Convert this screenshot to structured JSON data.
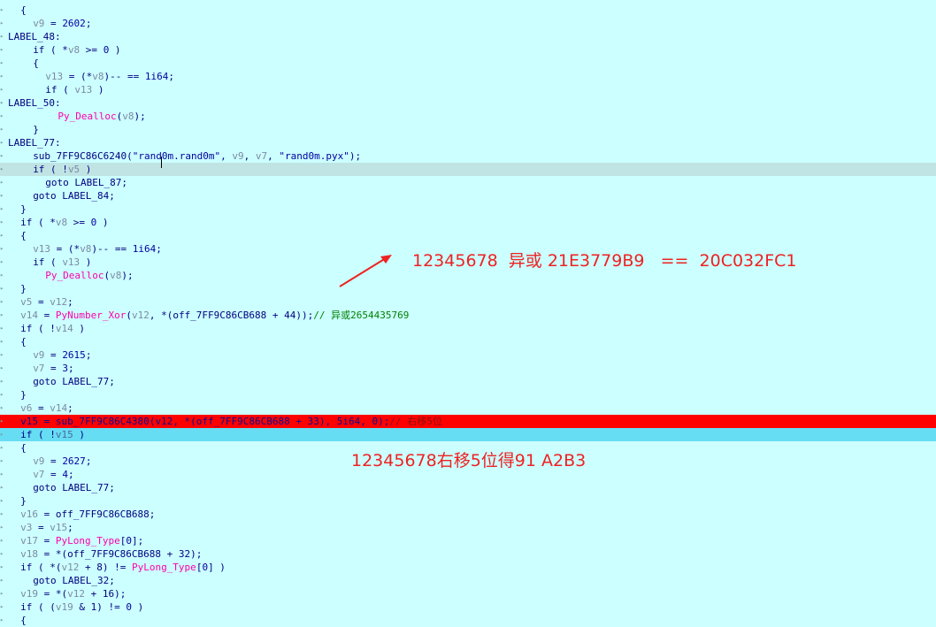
{
  "code_lines": [
    {
      "indent": 3,
      "tokens": [
        {
          "t": "pl",
          "v": "{"
        }
      ]
    },
    {
      "indent": 5,
      "tokens": [
        {
          "t": "var",
          "v": "v9"
        },
        {
          "t": "pl",
          "v": " = "
        },
        {
          "t": "num",
          "v": "2602"
        },
        {
          "t": "pl",
          "v": ";"
        }
      ]
    },
    {
      "indent": 1,
      "tokens": [
        {
          "t": "lbl",
          "v": "LABEL_48:"
        }
      ]
    },
    {
      "indent": 5,
      "tokens": [
        {
          "t": "kw",
          "v": "if"
        },
        {
          "t": "pl",
          "v": " ( *"
        },
        {
          "t": "var",
          "v": "v8"
        },
        {
          "t": "pl",
          "v": " >= "
        },
        {
          "t": "num",
          "v": "0"
        },
        {
          "t": "pl",
          "v": " )"
        }
      ]
    },
    {
      "indent": 5,
      "tokens": [
        {
          "t": "pl",
          "v": "{"
        }
      ]
    },
    {
      "indent": 7,
      "tokens": [
        {
          "t": "var",
          "v": "v13"
        },
        {
          "t": "pl",
          "v": " = (*"
        },
        {
          "t": "var",
          "v": "v8"
        },
        {
          "t": "pl",
          "v": ")-- == "
        },
        {
          "t": "num",
          "v": "1i64"
        },
        {
          "t": "pl",
          "v": ";"
        }
      ]
    },
    {
      "indent": 7,
      "tokens": [
        {
          "t": "kw",
          "v": "if"
        },
        {
          "t": "pl",
          "v": " ( "
        },
        {
          "t": "var",
          "v": "v13"
        },
        {
          "t": "pl",
          "v": " )"
        }
      ]
    },
    {
      "indent": 1,
      "tokens": [
        {
          "t": "lbl",
          "v": "LABEL_50:"
        }
      ]
    },
    {
      "indent": 9,
      "tokens": [
        {
          "t": "fn",
          "v": "Py_Dealloc"
        },
        {
          "t": "pl",
          "v": "("
        },
        {
          "t": "var",
          "v": "v8"
        },
        {
          "t": "pl",
          "v": ");"
        }
      ]
    },
    {
      "indent": 5,
      "tokens": [
        {
          "t": "pl",
          "v": "}"
        }
      ]
    },
    {
      "indent": 1,
      "tokens": [
        {
          "t": "lbl",
          "v": "LABEL_77:"
        }
      ]
    },
    {
      "indent": 5,
      "tokens": [
        {
          "t": "pl",
          "v": "sub_7FF9C86C6240("
        },
        {
          "t": "str",
          "v": "\"rand0m.rand0m\""
        },
        {
          "t": "pl",
          "v": ", "
        },
        {
          "t": "var",
          "v": "v9"
        },
        {
          "t": "pl",
          "v": ", "
        },
        {
          "t": "var",
          "v": "v7"
        },
        {
          "t": "pl",
          "v": ", "
        },
        {
          "t": "str",
          "v": "\"rand0m.pyx\""
        },
        {
          "t": "pl",
          "v": ");"
        }
      ]
    },
    {
      "indent": 5,
      "hl": "cursor",
      "tokens": [
        {
          "t": "kw",
          "v": "if"
        },
        {
          "t": "pl",
          "v": " ( !"
        },
        {
          "t": "var",
          "v": "v5"
        },
        {
          "t": "pl",
          "v": " )"
        }
      ]
    },
    {
      "indent": 7,
      "tokens": [
        {
          "t": "kw",
          "v": "goto"
        },
        {
          "t": "pl",
          "v": " LABEL_87;"
        }
      ]
    },
    {
      "indent": 5,
      "tokens": [
        {
          "t": "kw",
          "v": "goto"
        },
        {
          "t": "pl",
          "v": " LABEL_84;"
        }
      ]
    },
    {
      "indent": 3,
      "tokens": [
        {
          "t": "pl",
          "v": "}"
        }
      ]
    },
    {
      "indent": 3,
      "tokens": [
        {
          "t": "kw",
          "v": "if"
        },
        {
          "t": "pl",
          "v": " ( *"
        },
        {
          "t": "var",
          "v": "v8"
        },
        {
          "t": "pl",
          "v": " >= "
        },
        {
          "t": "num",
          "v": "0"
        },
        {
          "t": "pl",
          "v": " )"
        }
      ]
    },
    {
      "indent": 3,
      "tokens": [
        {
          "t": "pl",
          "v": "{"
        }
      ]
    },
    {
      "indent": 5,
      "tokens": [
        {
          "t": "var",
          "v": "v13"
        },
        {
          "t": "pl",
          "v": " = (*"
        },
        {
          "t": "var",
          "v": "v8"
        },
        {
          "t": "pl",
          "v": ")-- == "
        },
        {
          "t": "num",
          "v": "1i64"
        },
        {
          "t": "pl",
          "v": ";"
        }
      ]
    },
    {
      "indent": 5,
      "tokens": [
        {
          "t": "kw",
          "v": "if"
        },
        {
          "t": "pl",
          "v": " ( "
        },
        {
          "t": "var",
          "v": "v13"
        },
        {
          "t": "pl",
          "v": " )"
        }
      ]
    },
    {
      "indent": 7,
      "tokens": [
        {
          "t": "fn",
          "v": "Py_Dealloc"
        },
        {
          "t": "pl",
          "v": "("
        },
        {
          "t": "var",
          "v": "v8"
        },
        {
          "t": "pl",
          "v": ");"
        }
      ]
    },
    {
      "indent": 3,
      "tokens": [
        {
          "t": "pl",
          "v": "}"
        }
      ]
    },
    {
      "indent": 3,
      "tokens": [
        {
          "t": "var",
          "v": "v5"
        },
        {
          "t": "pl",
          "v": " = "
        },
        {
          "t": "var",
          "v": "v12"
        },
        {
          "t": "pl",
          "v": ";"
        }
      ]
    },
    {
      "indent": 3,
      "tokens": [
        {
          "t": "var",
          "v": "v14"
        },
        {
          "t": "pl",
          "v": " = "
        },
        {
          "t": "fn",
          "v": "PyNumber_Xor"
        },
        {
          "t": "pl",
          "v": "("
        },
        {
          "t": "var",
          "v": "v12"
        },
        {
          "t": "pl",
          "v": ", *(off_7FF9C86CB688 + 44));"
        },
        {
          "t": "cmt",
          "v": "// 异或2654435769"
        }
      ]
    },
    {
      "indent": 3,
      "tokens": [
        {
          "t": "kw",
          "v": "if"
        },
        {
          "t": "pl",
          "v": " ( !"
        },
        {
          "t": "var",
          "v": "v14"
        },
        {
          "t": "pl",
          "v": " )"
        }
      ]
    },
    {
      "indent": 3,
      "tokens": [
        {
          "t": "pl",
          "v": "{"
        }
      ]
    },
    {
      "indent": 5,
      "tokens": [
        {
          "t": "var",
          "v": "v9"
        },
        {
          "t": "pl",
          "v": " = "
        },
        {
          "t": "num",
          "v": "2615"
        },
        {
          "t": "pl",
          "v": ";"
        }
      ]
    },
    {
      "indent": 5,
      "tokens": [
        {
          "t": "var",
          "v": "v7"
        },
        {
          "t": "pl",
          "v": " = "
        },
        {
          "t": "num",
          "v": "3"
        },
        {
          "t": "pl",
          "v": ";"
        }
      ]
    },
    {
      "indent": 5,
      "tokens": [
        {
          "t": "kw",
          "v": "goto"
        },
        {
          "t": "pl",
          "v": " LABEL_77;"
        }
      ]
    },
    {
      "indent": 3,
      "tokens": [
        {
          "t": "pl",
          "v": "}"
        }
      ]
    },
    {
      "indent": 3,
      "tokens": [
        {
          "t": "var",
          "v": "v6"
        },
        {
          "t": "pl",
          "v": " = "
        },
        {
          "t": "var",
          "v": "v14"
        },
        {
          "t": "pl",
          "v": ";"
        }
      ]
    },
    {
      "indent": 3,
      "hl": "red",
      "tokens": [
        {
          "t": "var",
          "v": "v15"
        },
        {
          "t": "pl",
          "v": " = "
        },
        {
          "t": "fn",
          "v": "sub_7FF9C86C4380"
        },
        {
          "t": "pl",
          "v": "("
        },
        {
          "t": "var",
          "v": "v12"
        },
        {
          "t": "pl",
          "v": ", *(off_7FF9C86CB688 + 33), "
        },
        {
          "t": "num",
          "v": "5i64"
        },
        {
          "t": "pl",
          "v": ", "
        },
        {
          "t": "num",
          "v": "0"
        },
        {
          "t": "pl",
          "v": ");"
        },
        {
          "t": "cmt",
          "v": "// 右移5位"
        }
      ]
    },
    {
      "indent": 3,
      "hl": "blue",
      "tokens": [
        {
          "t": "kw",
          "v": "if"
        },
        {
          "t": "pl",
          "v": " ( !"
        },
        {
          "t": "var",
          "v": "v15"
        },
        {
          "t": "pl",
          "v": " )"
        }
      ]
    },
    {
      "indent": 3,
      "tokens": [
        {
          "t": "pl",
          "v": "{"
        }
      ]
    },
    {
      "indent": 5,
      "tokens": [
        {
          "t": "var",
          "v": "v9"
        },
        {
          "t": "pl",
          "v": " = "
        },
        {
          "t": "num",
          "v": "2627"
        },
        {
          "t": "pl",
          "v": ";"
        }
      ]
    },
    {
      "indent": 5,
      "tokens": [
        {
          "t": "var",
          "v": "v7"
        },
        {
          "t": "pl",
          "v": " = "
        },
        {
          "t": "num",
          "v": "4"
        },
        {
          "t": "pl",
          "v": ";"
        }
      ]
    },
    {
      "indent": 5,
      "tokens": [
        {
          "t": "kw",
          "v": "goto"
        },
        {
          "t": "pl",
          "v": " LABEL_77;"
        }
      ]
    },
    {
      "indent": 3,
      "tokens": [
        {
          "t": "pl",
          "v": "}"
        }
      ]
    },
    {
      "indent": 3,
      "tokens": [
        {
          "t": "var",
          "v": "v16"
        },
        {
          "t": "pl",
          "v": " = off_7FF9C86CB688;"
        }
      ]
    },
    {
      "indent": 3,
      "tokens": [
        {
          "t": "var",
          "v": "v3"
        },
        {
          "t": "pl",
          "v": " = "
        },
        {
          "t": "var",
          "v": "v15"
        },
        {
          "t": "pl",
          "v": ";"
        }
      ]
    },
    {
      "indent": 3,
      "tokens": [
        {
          "t": "var",
          "v": "v17"
        },
        {
          "t": "pl",
          "v": " = "
        },
        {
          "t": "fn",
          "v": "PyLong_Type"
        },
        {
          "t": "pl",
          "v": "["
        },
        {
          "t": "num",
          "v": "0"
        },
        {
          "t": "pl",
          "v": "];"
        }
      ]
    },
    {
      "indent": 3,
      "tokens": [
        {
          "t": "var",
          "v": "v18"
        },
        {
          "t": "pl",
          "v": " = *(off_7FF9C86CB688 + 32);"
        }
      ]
    },
    {
      "indent": 3,
      "tokens": [
        {
          "t": "kw",
          "v": "if"
        },
        {
          "t": "pl",
          "v": " ( *("
        },
        {
          "t": "var",
          "v": "v12"
        },
        {
          "t": "pl",
          "v": " + 8) != "
        },
        {
          "t": "fn",
          "v": "PyLong_Type"
        },
        {
          "t": "pl",
          "v": "["
        },
        {
          "t": "num",
          "v": "0"
        },
        {
          "t": "pl",
          "v": "] )"
        }
      ]
    },
    {
      "indent": 5,
      "tokens": [
        {
          "t": "kw",
          "v": "goto"
        },
        {
          "t": "pl",
          "v": " LABEL_32;"
        }
      ]
    },
    {
      "indent": 3,
      "tokens": [
        {
          "t": "var",
          "v": "v19"
        },
        {
          "t": "pl",
          "v": " = *("
        },
        {
          "t": "var",
          "v": "v12"
        },
        {
          "t": "pl",
          "v": " + 16);"
        }
      ]
    },
    {
      "indent": 3,
      "tokens": [
        {
          "t": "kw",
          "v": "if"
        },
        {
          "t": "pl",
          "v": " ( ("
        },
        {
          "t": "var",
          "v": "v19"
        },
        {
          "t": "pl",
          "v": " & 1) != "
        },
        {
          "t": "num",
          "v": "0"
        },
        {
          "t": "pl",
          "v": " )"
        }
      ]
    },
    {
      "indent": 3,
      "tokens": [
        {
          "t": "pl",
          "v": "{"
        }
      ]
    }
  ],
  "annotations": {
    "xor_note": "12345678  异或 21E3779B9   ==  20C032FC1",
    "shift_note": "12345678右移5位得91 A2B3"
  },
  "colors": {
    "background": "#ccffff",
    "cursor_line": "#c0e4e4",
    "error_line": "#ff0000",
    "selected_line": "#66ddf3",
    "annotation": "#ee2222"
  }
}
